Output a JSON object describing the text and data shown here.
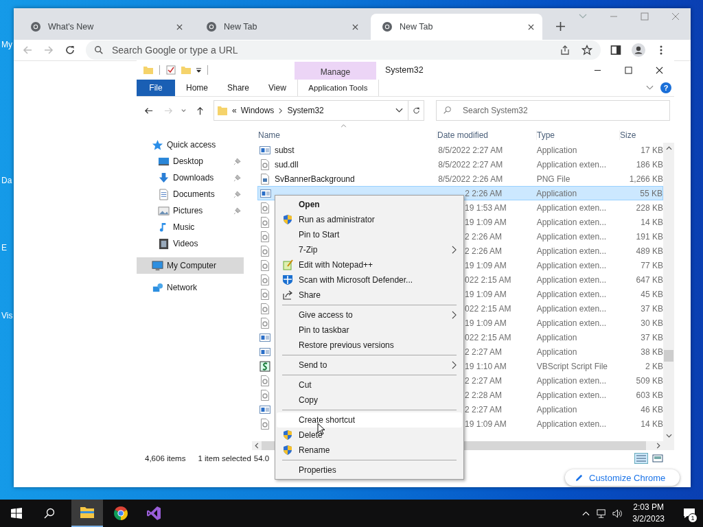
{
  "desktop": {
    "icon_labels": [
      "My",
      "Da",
      "E",
      "Vis"
    ]
  },
  "browser": {
    "tabs": [
      {
        "title": "What's New",
        "selected": false
      },
      {
        "title": "New Tab",
        "selected": false
      },
      {
        "title": "New Tab",
        "selected": true
      }
    ],
    "omnibox": {
      "placeholder": "Search Google or type a URL"
    },
    "customize_button": "Customize Chrome"
  },
  "explorer": {
    "title": "System32",
    "context_tab": "Manage",
    "help": "?",
    "ribbon_tabs": [
      {
        "label": "File",
        "kind": "file"
      },
      {
        "label": "Home",
        "kind": "tab"
      },
      {
        "label": "Share",
        "kind": "tab"
      },
      {
        "label": "View",
        "kind": "tab"
      },
      {
        "label": "Application Tools",
        "kind": "context"
      }
    ],
    "address": {
      "overflow": "«",
      "segments": [
        "Windows",
        "System32"
      ]
    },
    "search": {
      "placeholder": "Search System32"
    },
    "nav": [
      {
        "label": "Quick access",
        "kind": "star",
        "selected": false,
        "children": [
          {
            "label": "Desktop",
            "kind": "desktop",
            "pinned": true,
            "selected": false
          },
          {
            "label": "Downloads",
            "kind": "download",
            "pinned": true,
            "selected": false
          },
          {
            "label": "Documents",
            "kind": "document",
            "pinned": true,
            "selected": false
          },
          {
            "label": "Pictures",
            "kind": "pictures",
            "pinned": true,
            "selected": false
          },
          {
            "label": "Music",
            "kind": "music",
            "pinned": false,
            "selected": false
          },
          {
            "label": "Videos",
            "kind": "videos",
            "pinned": false,
            "selected": false
          }
        ]
      },
      {
        "label": "My Computer",
        "kind": "computer",
        "selected": true
      },
      {
        "label": "Network",
        "kind": "network",
        "selected": false
      }
    ],
    "columns": [
      "Name",
      "Date modified",
      "Type",
      "Size"
    ],
    "rows": [
      {
        "kind": "app",
        "name": "subst",
        "date": "8/5/2022 2:27 AM",
        "type": "Application",
        "size": "17 KB",
        "selected": false
      },
      {
        "kind": "dll",
        "name": "sud.dll",
        "date": "8/5/2022 2:27 AM",
        "type": "Application exten...",
        "size": "186 KB",
        "selected": false
      },
      {
        "kind": "png",
        "name": "SvBannerBackground",
        "date": "8/5/2022 2:26 AM",
        "type": "PNG File",
        "size": "1,266 KB",
        "selected": false
      },
      {
        "kind": "app",
        "date": "2 2:26 AM",
        "type": "Application",
        "size": "55 KB",
        "selected": true
      },
      {
        "kind": "dll",
        "date": "19 1:53 AM",
        "type": "Application exten...",
        "size": "228 KB",
        "selected": false
      },
      {
        "kind": "dll",
        "date": "19 1:09 AM",
        "type": "Application exten...",
        "size": "14 KB",
        "selected": false
      },
      {
        "kind": "dll",
        "date": "2 2:26 AM",
        "type": "Application exten...",
        "size": "191 KB",
        "selected": false
      },
      {
        "kind": "dll",
        "date": "2 2:26 AM",
        "type": "Application exten...",
        "size": "489 KB",
        "selected": false
      },
      {
        "kind": "dll",
        "date": "19 1:09 AM",
        "type": "Application exten...",
        "size": "77 KB",
        "selected": false
      },
      {
        "kind": "dll",
        "date": "022 2:15 AM",
        "type": "Application exten...",
        "size": "647 KB",
        "selected": false
      },
      {
        "kind": "dll",
        "date": "19 1:09 AM",
        "type": "Application exten...",
        "size": "45 KB",
        "selected": false
      },
      {
        "kind": "dll",
        "date": "022 2:15 AM",
        "type": "Application exten...",
        "size": "37 KB",
        "selected": false
      },
      {
        "kind": "dll",
        "date": "19 1:09 AM",
        "type": "Application exten...",
        "size": "30 KB",
        "selected": false
      },
      {
        "kind": "app",
        "date": "022 2:15 AM",
        "type": "Application",
        "size": "37 KB",
        "selected": false
      },
      {
        "kind": "app",
        "date": "2 2:27 AM",
        "type": "Application",
        "size": "38 KB",
        "selected": false
      },
      {
        "kind": "vbs",
        "date": "19 1:10 AM",
        "type": "VBScript Script File",
        "size": "2 KB",
        "selected": false
      },
      {
        "kind": "dll",
        "date": "2 2:27 AM",
        "type": "Application exten...",
        "size": "509 KB",
        "selected": false
      },
      {
        "kind": "dll",
        "date": "2 2:28 AM",
        "type": "Application exten...",
        "size": "603 KB",
        "selected": false
      },
      {
        "kind": "app",
        "date": "2 2:27 AM",
        "type": "Application",
        "size": "46 KB",
        "selected": false
      },
      {
        "kind": "dll",
        "date": "19 1:09 AM",
        "type": "Application exten...",
        "size": "14 KB",
        "selected": false
      }
    ],
    "status": {
      "items": "4,606 items",
      "selection": "1 item selected",
      "size": "54.0"
    }
  },
  "context_menu": [
    {
      "kind": "item",
      "label": "Open",
      "bold": true,
      "submenu": false,
      "selected": false
    },
    {
      "kind": "item",
      "label": "Run as administrator",
      "bold": false,
      "submenu": false,
      "selected": false
    },
    {
      "kind": "item",
      "label": "Pin to Start",
      "bold": false,
      "submenu": false,
      "selected": false
    },
    {
      "kind": "item",
      "label": "7-Zip",
      "bold": false,
      "submenu": true,
      "selected": false
    },
    {
      "kind": "item",
      "label": "Edit with Notepad++",
      "bold": false,
      "submenu": false,
      "selected": false
    },
    {
      "kind": "item",
      "label": "Scan with Microsoft Defender...",
      "bold": false,
      "submenu": false,
      "selected": false
    },
    {
      "kind": "item",
      "label": "Share",
      "bold": false,
      "submenu": false,
      "selected": false
    },
    {
      "kind": "separator"
    },
    {
      "kind": "item",
      "label": "Give access to",
      "bold": false,
      "submenu": true,
      "selected": false
    },
    {
      "kind": "item",
      "label": "Pin to taskbar",
      "bold": false,
      "submenu": false,
      "selected": false
    },
    {
      "kind": "item",
      "label": "Restore previous versions",
      "bold": false,
      "submenu": false,
      "selected": false
    },
    {
      "kind": "separator"
    },
    {
      "kind": "item",
      "label": "Send to",
      "bold": false,
      "submenu": true,
      "selected": false
    },
    {
      "kind": "separator"
    },
    {
      "kind": "item",
      "label": "Cut",
      "bold": false,
      "submenu": false,
      "selected": false
    },
    {
      "kind": "item",
      "label": "Copy",
      "bold": false,
      "submenu": false,
      "selected": false
    },
    {
      "kind": "separator"
    },
    {
      "kind": "item",
      "label": "Create shortcut",
      "bold": false,
      "submenu": false,
      "selected": true
    },
    {
      "kind": "item",
      "label": "Delete",
      "bold": false,
      "submenu": false,
      "selected": false
    },
    {
      "kind": "item",
      "label": "Rename",
      "bold": false,
      "submenu": false,
      "selected": false
    },
    {
      "kind": "separator"
    },
    {
      "kind": "item",
      "label": "Properties",
      "bold": false,
      "submenu": false,
      "selected": false
    }
  ],
  "taskbar": {
    "apps": [
      {
        "kind": "explorer",
        "active": true
      },
      {
        "kind": "chrome",
        "active": false
      },
      {
        "kind": "studio",
        "active": false
      }
    ],
    "clock": {
      "time": "2:03 PM",
      "date": "3/2/2023"
    },
    "notifications": "1"
  }
}
